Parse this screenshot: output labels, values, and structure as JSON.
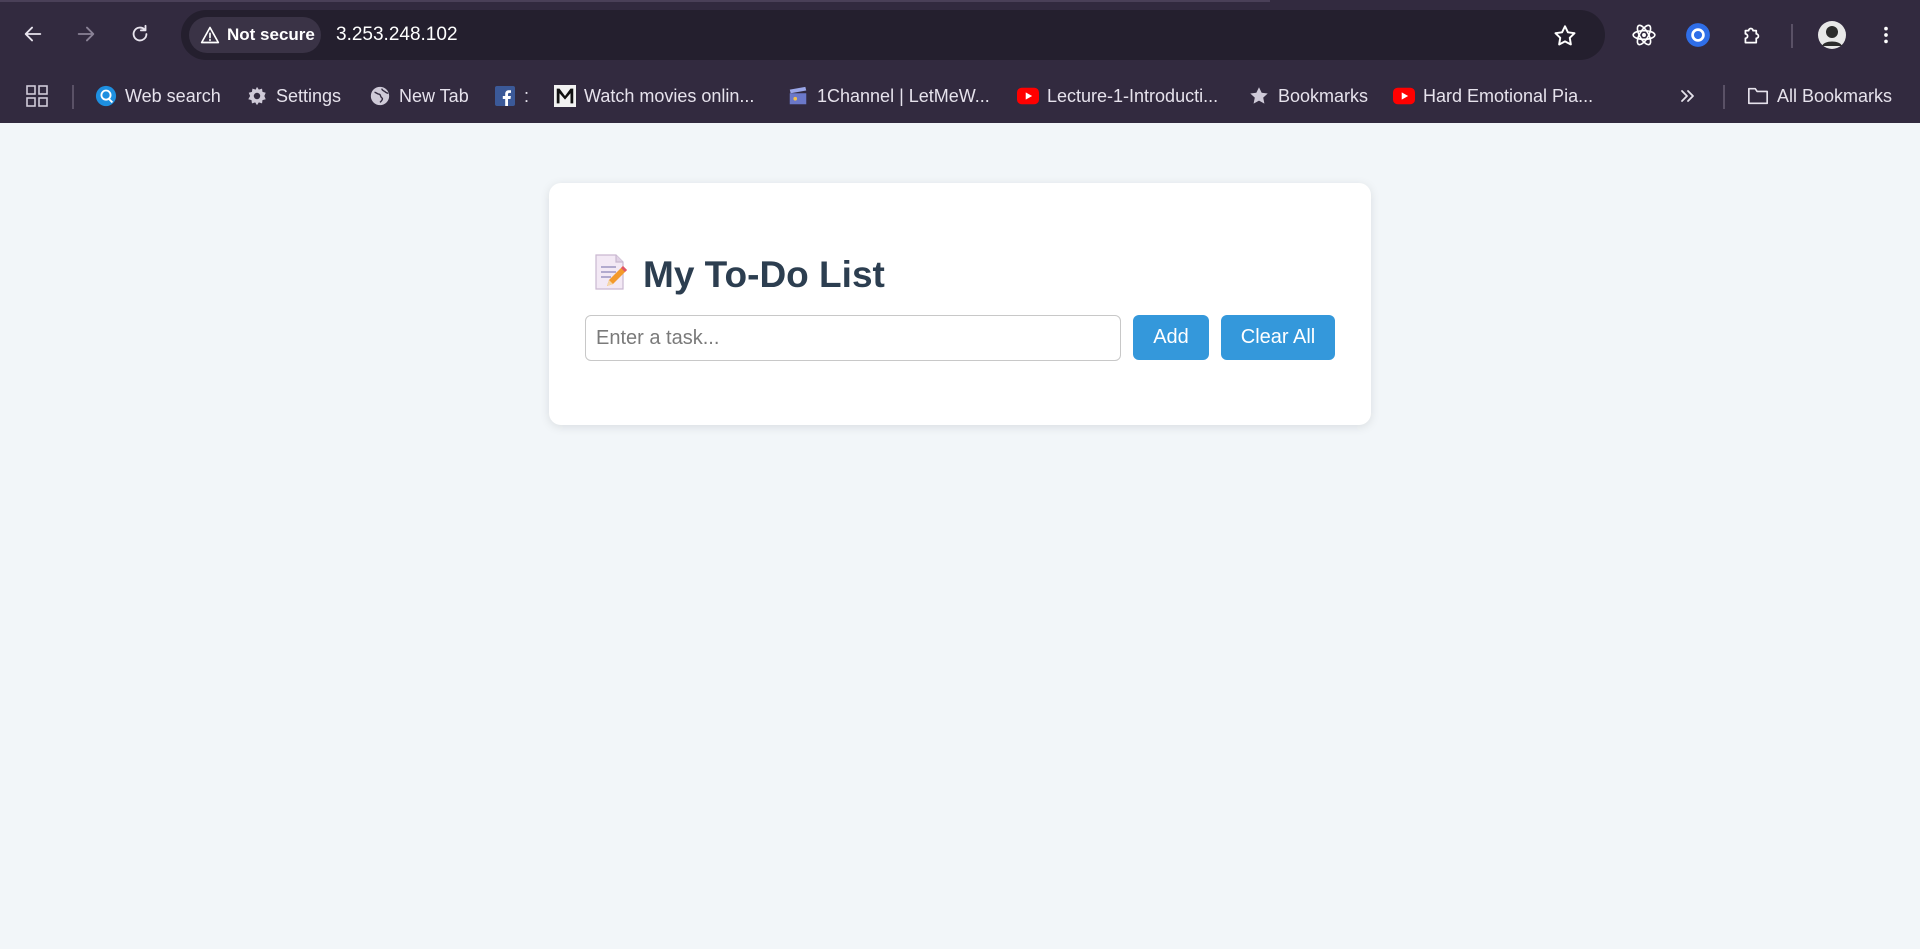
{
  "browser": {
    "security_label": "Not secure",
    "url": "3.253.248.102",
    "back_icon": "arrow-left-icon",
    "forward_icon": "arrow-right-icon",
    "reload_icon": "reload-icon"
  },
  "bookmarks": {
    "items": [
      {
        "label": "Web search",
        "icon": "web-search-icon"
      },
      {
        "label": "Settings",
        "icon": "gear-icon"
      },
      {
        "label": "New Tab",
        "icon": "globe-icon"
      },
      {
        "label": ":",
        "icon": "facebook-icon"
      },
      {
        "label": "Watch movies onlin...",
        "icon": "m-logo-icon"
      },
      {
        "label": "1Channel | LetMeW...",
        "icon": "clapperboard-icon"
      },
      {
        "label": "Lecture-1-Introducti...",
        "icon": "youtube-icon"
      },
      {
        "label": "Bookmarks",
        "icon": "star-icon"
      },
      {
        "label": "Hard Emotional Pia...",
        "icon": "youtube-icon"
      }
    ],
    "all_bookmarks_label": "All Bookmarks"
  },
  "app": {
    "title_emoji": "📝",
    "title": "My To-Do List",
    "input_placeholder": "Enter a task...",
    "input_value": "",
    "add_label": "Add",
    "clear_label": "Clear All",
    "accent_color": "#3498db"
  }
}
